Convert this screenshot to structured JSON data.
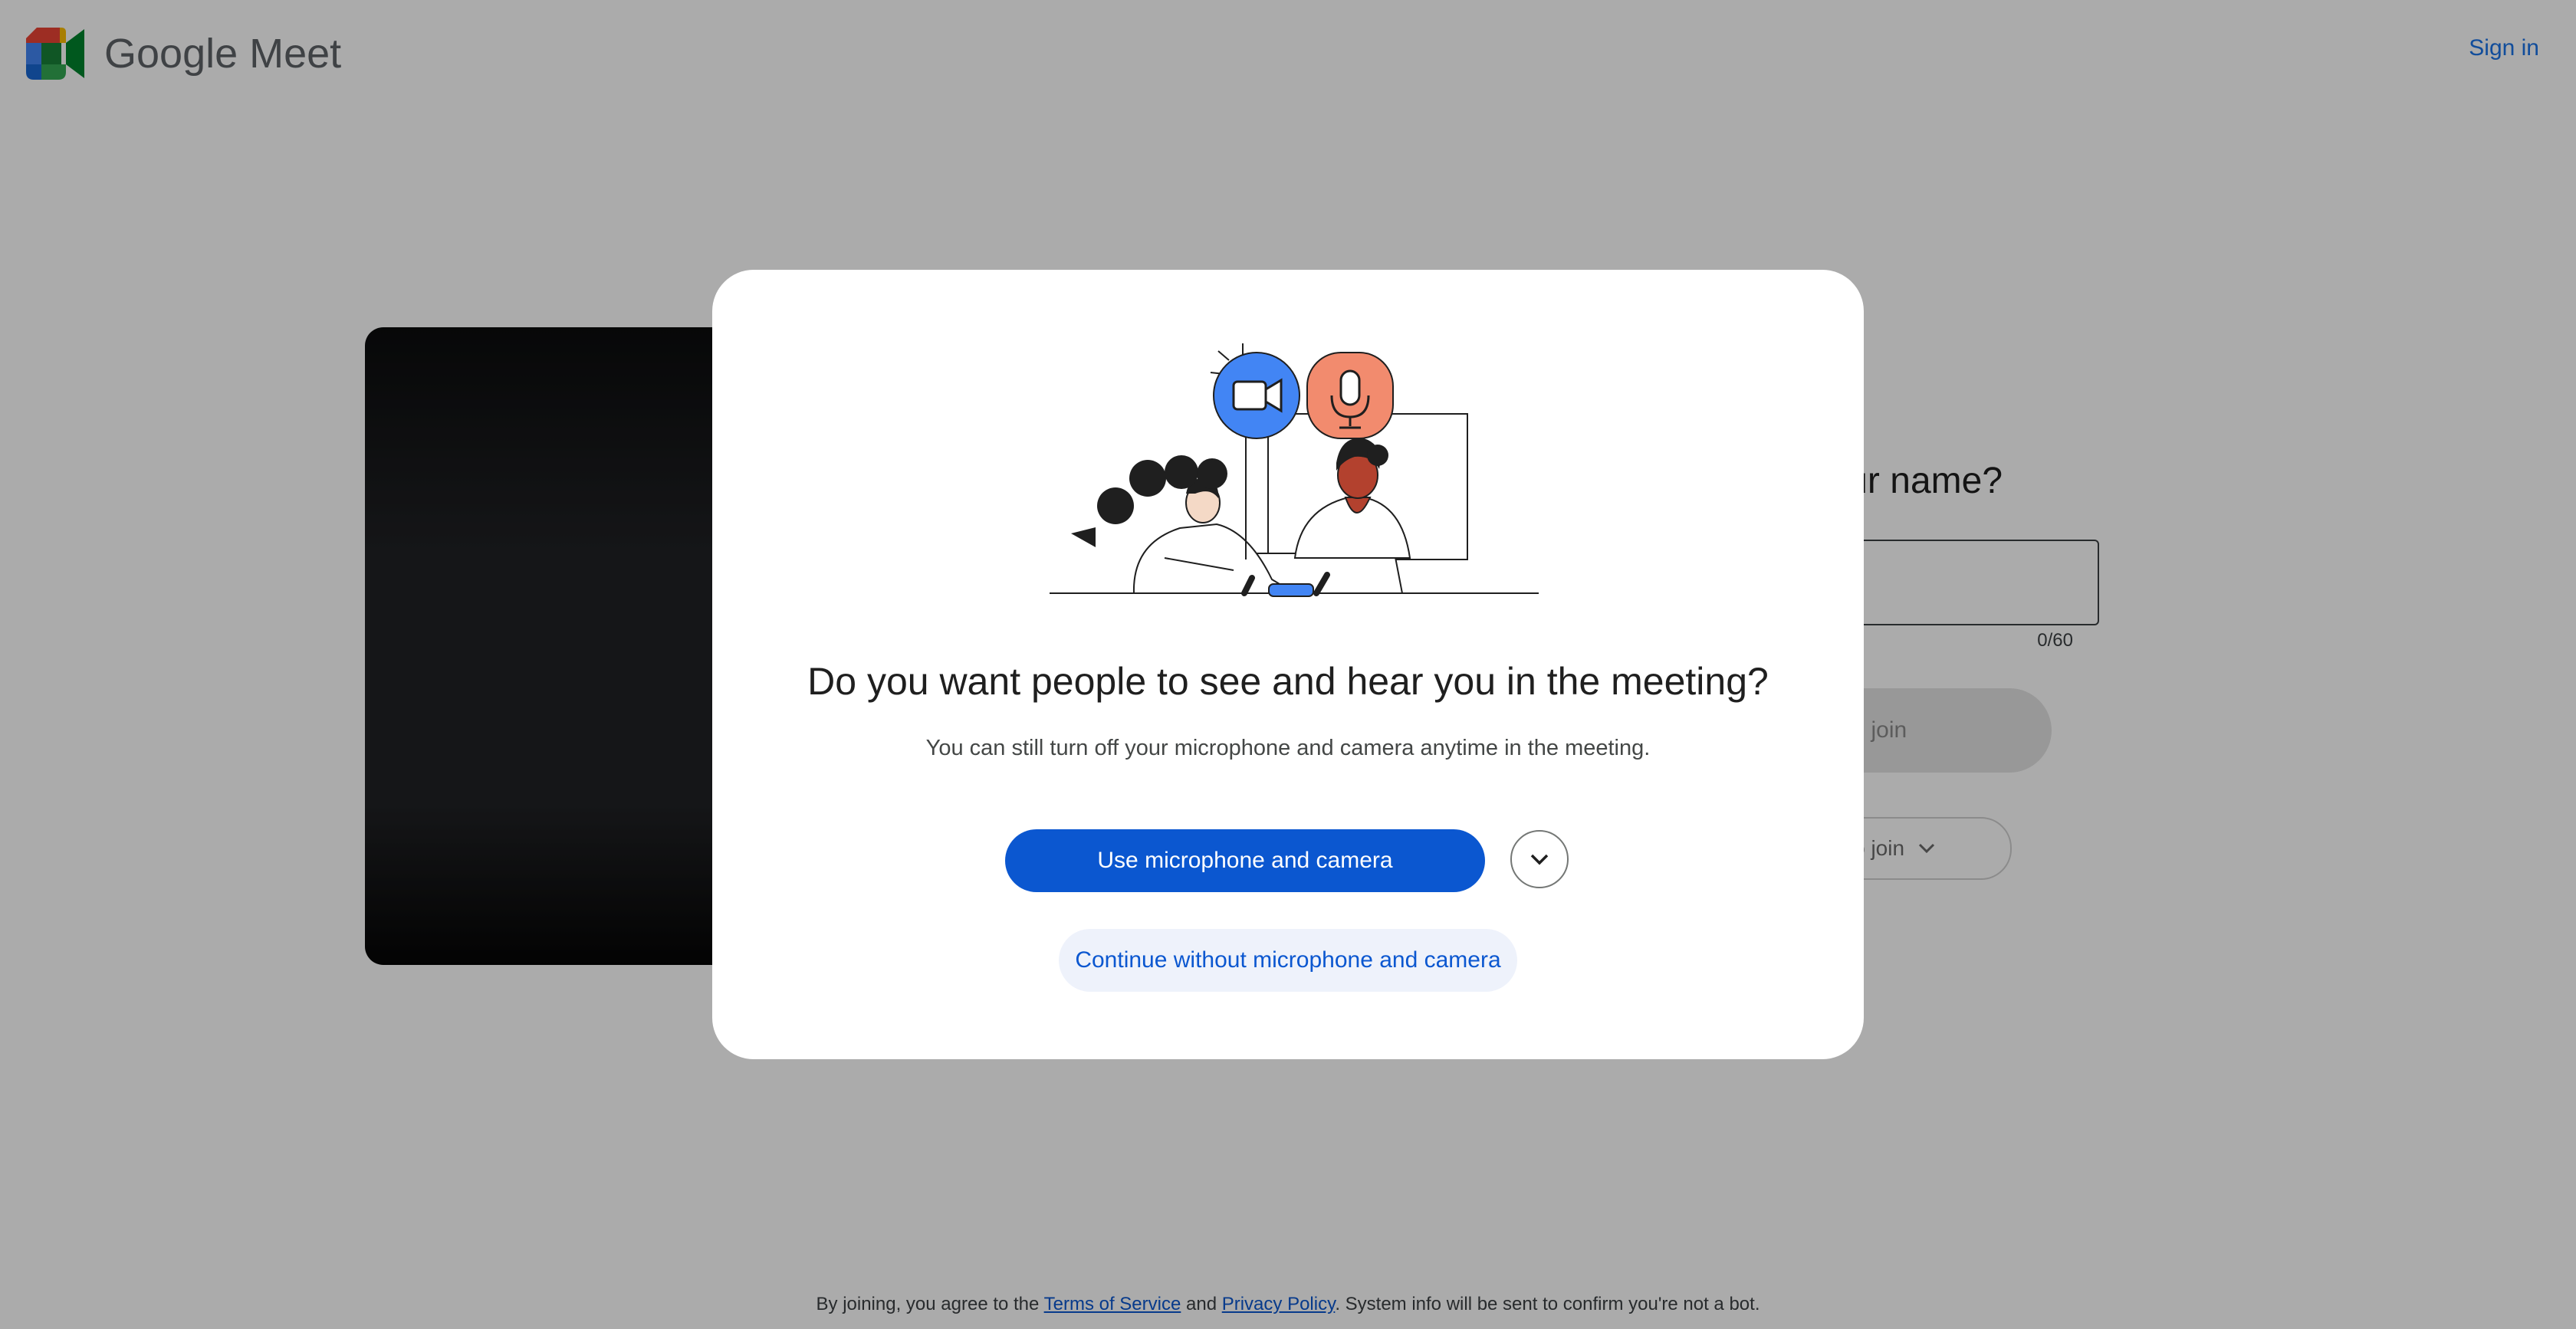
{
  "app": {
    "brand": "Google Meet",
    "sign_in": "Sign in"
  },
  "join": {
    "question": "What's your name?",
    "name_value": "",
    "counter": "0/60",
    "ask_button": "Ask to join",
    "other_ways": "Other ways to join"
  },
  "dialog": {
    "title": "Do you want people to see and hear you in the meeting?",
    "subtitle": "You can still turn off your microphone and camera anytime in the meeting.",
    "primary_button": "Use microphone and camera",
    "secondary_button": "Continue without microphone and camera",
    "more_options_icon": "chevron-down-icon"
  },
  "footer": {
    "prefix": "By joining, you agree to the ",
    "terms": "Terms of Service",
    "and": " and ",
    "privacy": "Privacy Policy",
    "suffix": ". System info will be sent to confirm you're not a bot."
  },
  "colors": {
    "accent": "#0b57d0",
    "camera_badge": "#4285f4",
    "mic_badge": "#f28b6e"
  }
}
